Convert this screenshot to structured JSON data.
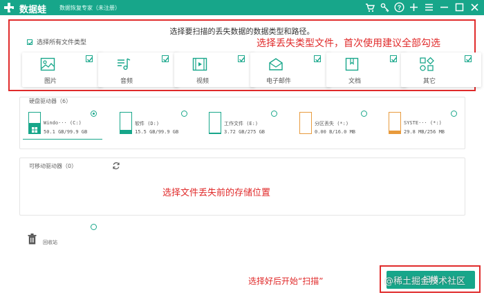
{
  "titlebar": {
    "app_name": "数据蛙",
    "app_subtitle": "数据恢复专家（未注册）",
    "icons": [
      "cart-icon",
      "key-icon",
      "help-icon",
      "plus-icon",
      "menu-icon",
      "minimize-icon",
      "maximize-icon",
      "close-icon"
    ],
    "bg_color": "#17a68a"
  },
  "file_types": {
    "title": "选择要扫描的丢失数据的数据类型和路径。",
    "select_all_label": "选择所有文件类型",
    "select_all_checked": true,
    "items": [
      {
        "label": "图片",
        "icon": "image-icon",
        "checked": true
      },
      {
        "label": "音频",
        "icon": "music-icon",
        "checked": true
      },
      {
        "label": "视频",
        "icon": "video-icon",
        "checked": true
      },
      {
        "label": "电子邮件",
        "icon": "email-icon",
        "checked": true
      },
      {
        "label": "文档",
        "icon": "document-icon",
        "checked": true
      },
      {
        "label": "其它",
        "icon": "other-icon",
        "checked": true
      }
    ]
  },
  "annotations": {
    "file_type_hint": "选择丢失类型文件，首次使用建议全部勾选",
    "location_hint": "选择文件丢失前的存储位置",
    "scan_hint": "选择好后开始“扫描”",
    "color": "#e02a2a"
  },
  "hard_drives": {
    "label": "硬盘驱动器（6）",
    "drives": [
      {
        "name": "Windo··· (C:)",
        "size": "50.1 GB/99.9 GB",
        "fill": 0.5,
        "selected": true,
        "has_windows_logo": true
      },
      {
        "name": "软件 (D:)",
        "size": "15.5 GB/99.9 GB",
        "fill": 0.16,
        "selected": false
      },
      {
        "name": "工作文件 (E:)",
        "size": "3.72 GB/275 GB",
        "fill": 0.02,
        "selected": false
      },
      {
        "name": "分区丢失 (*:)",
        "size": "0.00  B/16.0 MB",
        "fill": 0.0,
        "selected": false,
        "warn": true
      },
      {
        "name": "SYSTE··· (*:)",
        "size": "29.8 MB/256 MB",
        "fill": 0.12,
        "selected": false,
        "warn": true
      }
    ]
  },
  "removable": {
    "label": "可移动驱动器（0）",
    "refresh_icon": "refresh-icon"
  },
  "recycle_bin": {
    "label": "回收站",
    "icon": "trash-icon",
    "selected": false
  },
  "scan_button": {
    "label": "扫描"
  },
  "watermark": "@稀土掘金技术社区"
}
